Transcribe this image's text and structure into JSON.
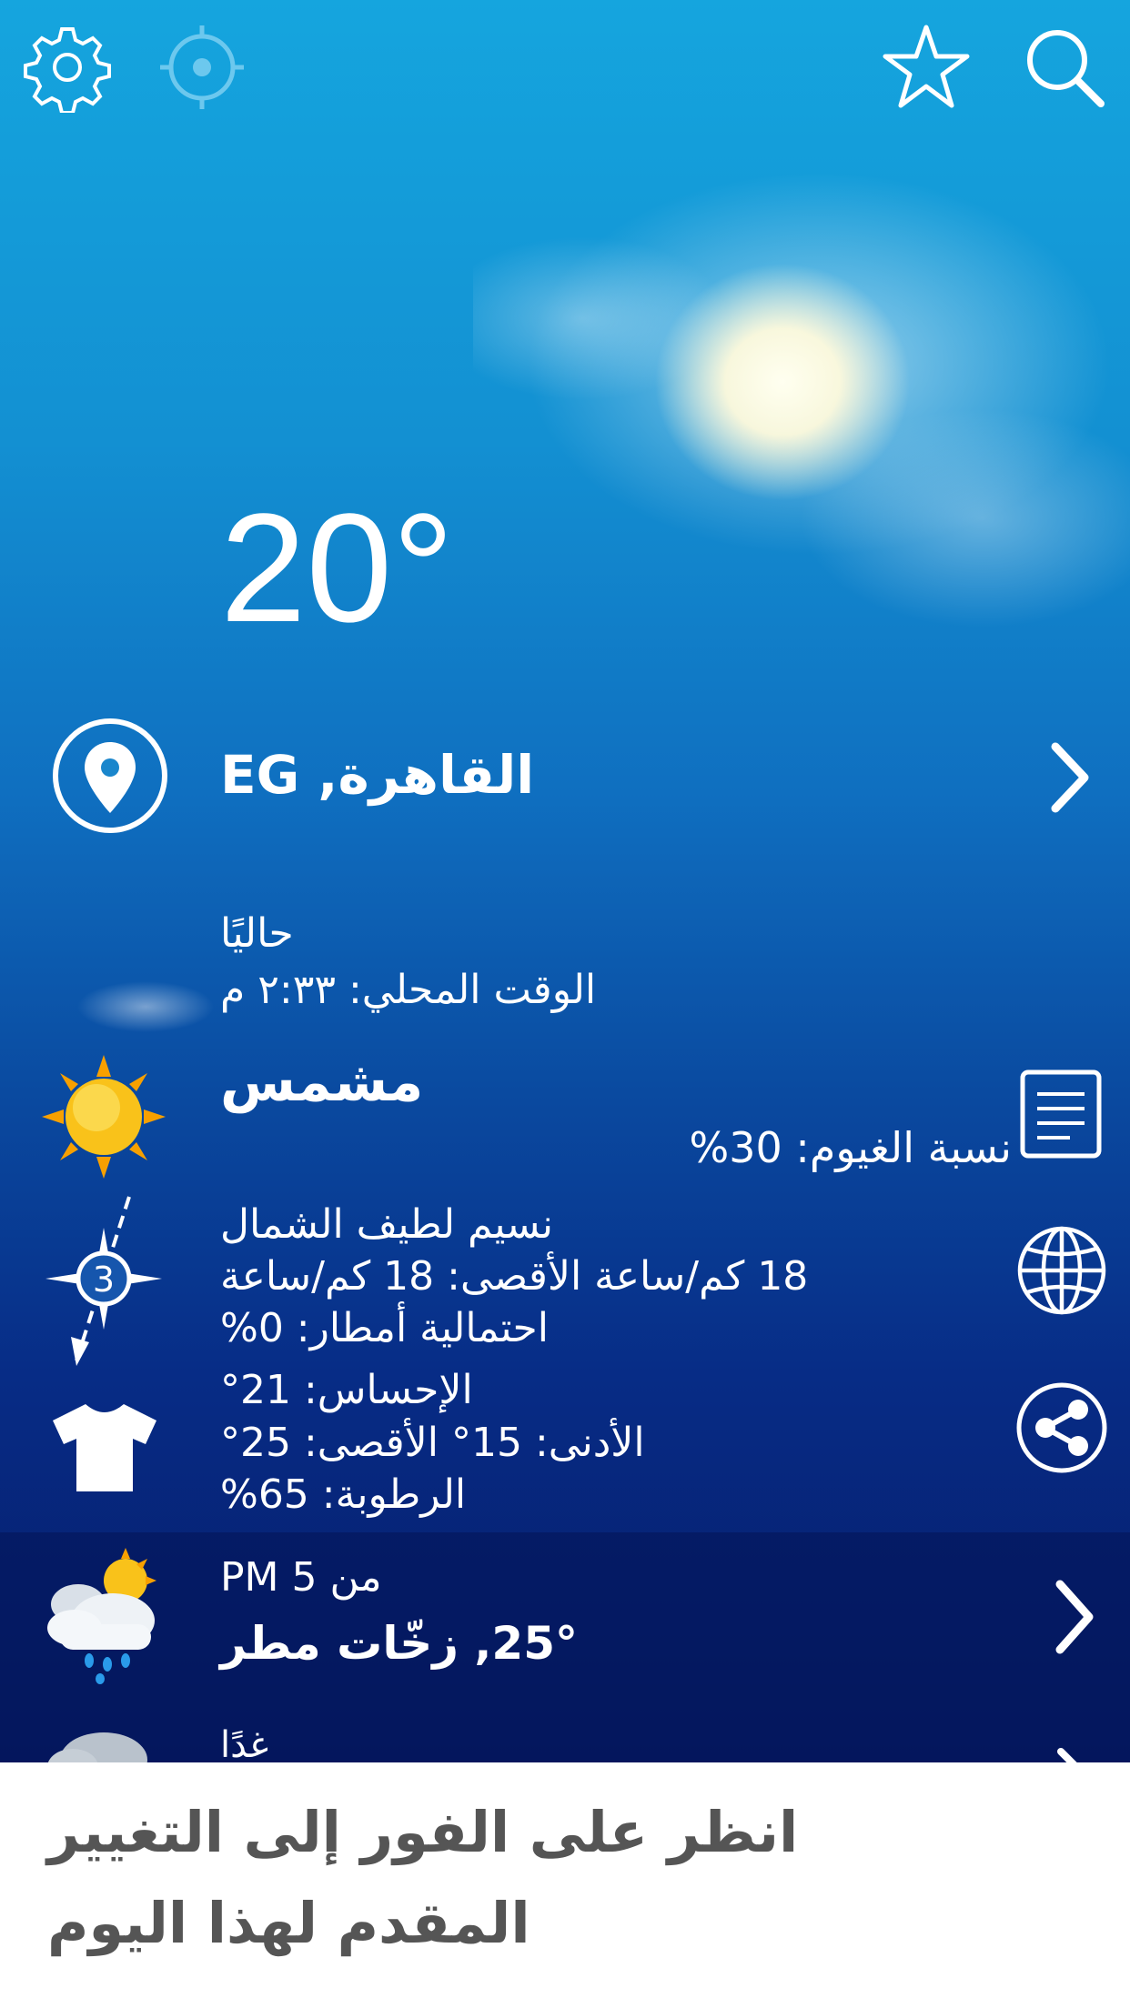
{
  "toolbar": {
    "settings_icon": "gear-icon",
    "locate_icon": "crosshair-icon",
    "favorite_icon": "star-icon",
    "search_icon": "search-icon"
  },
  "current": {
    "temperature": "20°",
    "location": "القاهرة, EG",
    "label_now": "حاليًا",
    "local_time": "الوقت المحلي: ٢:٣٣ م",
    "condition": "مشمس",
    "cloud_cover": "نسبة الغيوم: 30%",
    "wind_name": "نسيم لطيف الشمال",
    "wind_speed": "18 كم/ساعة الأقصى: 18 كم/ساعة",
    "rain_chance": "احتمالية أمطار: 0%",
    "wind_beaufort": "3",
    "feels_like": "الإحساس: 21°",
    "min_max": "الأدنى: 15°  الأقصى: 25°",
    "humidity": "الرطوبة: 65%"
  },
  "forecast": {
    "next_time": "من 5 PM",
    "next_summary": "25°, زخّات مطر",
    "tomorrow_label": "غدًا"
  },
  "caption": {
    "line1": "انظر على الفور إلى التغيير",
    "line2": "المقدم لهذا اليوم"
  },
  "colors": {
    "sky_top": "#15a5de",
    "sky_bottom": "#061a66",
    "sun": "#f7b500"
  }
}
